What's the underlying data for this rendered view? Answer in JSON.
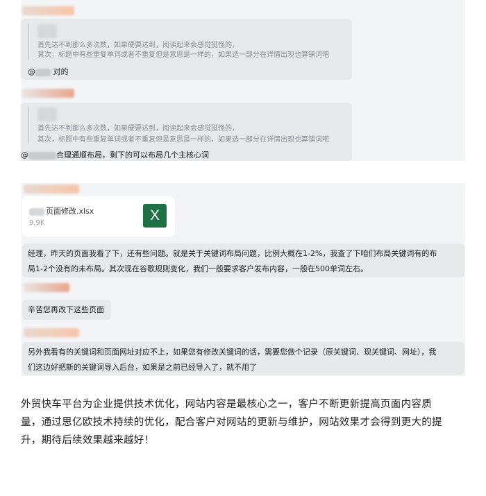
{
  "quote_block": {
    "line1": "首先达不到那么多次数，如果硬要达到，阅读起来会感觉挺怪的，",
    "line2": "其次，标题中有些重复单词或者不重复但是意思是一样的，如果选一部分在详情出现也算铺词吧"
  },
  "reply_1": {
    "prefix": "@",
    "text": "对的"
  },
  "reply_2": {
    "prefix": "@",
    "text": "合理通顺布局，剩下的可以布局几个主核心词"
  },
  "file_card": {
    "name": "页面修改.xlsx",
    "size": "9.9K",
    "icon": "excel-icon",
    "icon_letter": "X",
    "icon_color": "#1d7044"
  },
  "messages": [
    {
      "lines": [
        "经理，昨天的页面我看了下，还有些问题。就是关于关键词布局问题，比例大概在1-2%，我查了下咱们布局关键词有的布",
        "局1-2个没有的未布局。其次现在谷歌规则变化，我们一般要求客户发布内容，一般在500单词左右。"
      ]
    },
    {
      "lines": [
        "辛苦您再改下这些页面"
      ]
    },
    {
      "lines": [
        "另外我看有的关键词和页面网址对应不上，如果您有修改关键词的话，需要您做个记录（原关键词、现关键词、网址），我",
        "们这边好把新的关键词导入后台，如果是之前已经导入了，就不用了"
      ]
    }
  ],
  "article": {
    "lines": [
      "外贸快车平台为企业提供技术优化，网站内容是最核心之一，客户不断更新提高页面内容质",
      "量，通过思亿欧技术持续的优化，配合客户对网站的更新与维护，网站效果才会得到更大的提",
      "升，期待后续效果越来越好！"
    ]
  },
  "colors": {
    "panel_bg": "#f3f4f6",
    "bubble_bg": "#e7e8ea",
    "excel_green": "#1d7044"
  }
}
